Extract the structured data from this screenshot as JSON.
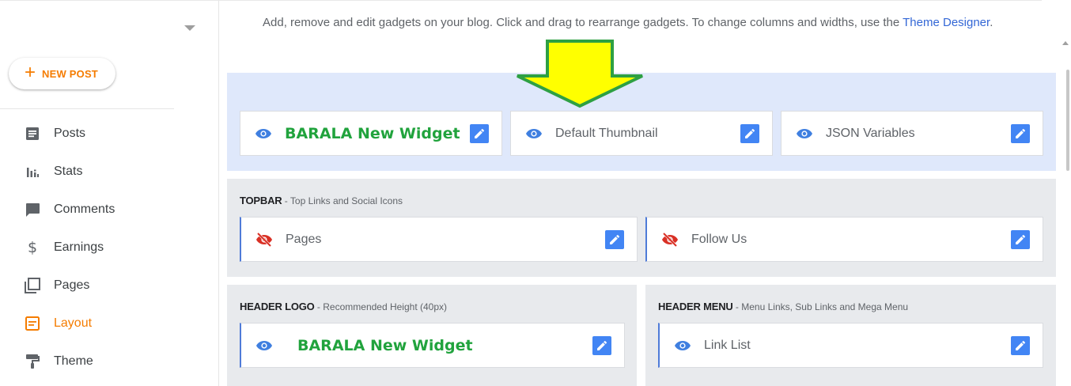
{
  "sidebar": {
    "new_post_label": "NEW POST",
    "items": [
      {
        "label": "Posts",
        "icon": "posts-icon"
      },
      {
        "label": "Stats",
        "icon": "stats-icon"
      },
      {
        "label": "Comments",
        "icon": "comments-icon"
      },
      {
        "label": "Earnings",
        "icon": "dollar-icon"
      },
      {
        "label": "Pages",
        "icon": "pages-icon"
      },
      {
        "label": "Layout",
        "icon": "layout-icon",
        "active": true
      },
      {
        "label": "Theme",
        "icon": "paint-roller-icon"
      }
    ]
  },
  "main": {
    "description": "Add, remove and edit gadgets on your blog. Click and drag to rearrange gadgets. To change columns and widths, use the",
    "theme_designer_link": "Theme Designer",
    "description_end": ".",
    "sections": {
      "top": {
        "gadgets": [
          {
            "label": "BARALA New Widget",
            "visible": true
          },
          {
            "label": "Default Thumbnail",
            "visible": true
          },
          {
            "label": "JSON Variables",
            "visible": true
          }
        ]
      },
      "topbar": {
        "title": "TOPBAR",
        "subtitle": " - Top Links and Social Icons",
        "gadgets": [
          {
            "label": "Pages",
            "visible": false
          },
          {
            "label": "Follow Us",
            "visible": false
          }
        ]
      },
      "header_logo": {
        "title": "HEADER LOGO",
        "subtitle": " - Recommended Height (40px)",
        "gadgets": [
          {
            "label": "BARALA New Widget",
            "visible": true
          }
        ]
      },
      "header_menu": {
        "title": "HEADER MENU",
        "subtitle": " - Menu Links, Sub Links and Mega Menu",
        "gadgets": [
          {
            "label": "Link List",
            "visible": true
          }
        ]
      }
    }
  },
  "colors": {
    "accent_orange": "#f57c00",
    "edit_blue": "#4285f4",
    "eye_blue": "#3f7fe0",
    "hidden_red": "#d93025",
    "annotation_green": "#21a33d",
    "annotation_arrow_fill": "#ffff00"
  }
}
